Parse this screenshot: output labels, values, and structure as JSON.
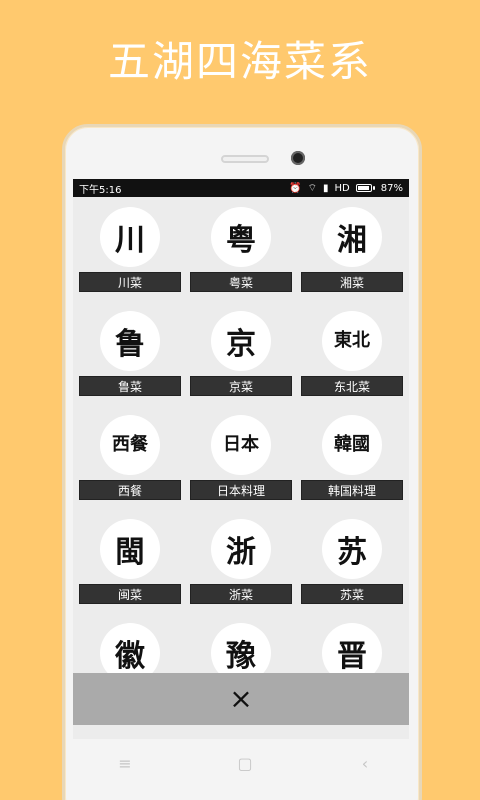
{
  "headline": "五湖四海菜系",
  "status": {
    "time": "下午5:16",
    "network": "HD",
    "battery": "87%"
  },
  "cuisines": [
    {
      "glyph": "川",
      "label": "川菜"
    },
    {
      "glyph": "粤",
      "label": "粤菜"
    },
    {
      "glyph": "湘",
      "label": "湘菜"
    },
    {
      "glyph": "鲁",
      "label": "鲁菜"
    },
    {
      "glyph": "京",
      "label": "京菜"
    },
    {
      "glyph": "東北",
      "label": "东北菜"
    },
    {
      "glyph": "西餐",
      "label": "西餐"
    },
    {
      "glyph": "日本",
      "label": "日本料理"
    },
    {
      "glyph": "韓國",
      "label": "韩国料理"
    },
    {
      "glyph": "閩",
      "label": "闽菜"
    },
    {
      "glyph": "浙",
      "label": "浙菜"
    },
    {
      "glyph": "苏",
      "label": "苏菜"
    },
    {
      "glyph": "徽",
      "label": ""
    },
    {
      "glyph": "豫",
      "label": ""
    },
    {
      "glyph": "晋",
      "label": ""
    }
  ],
  "close": {
    "icon": "×"
  },
  "navbar": {
    "menu": "≡",
    "home": "▢",
    "back": "‹"
  }
}
